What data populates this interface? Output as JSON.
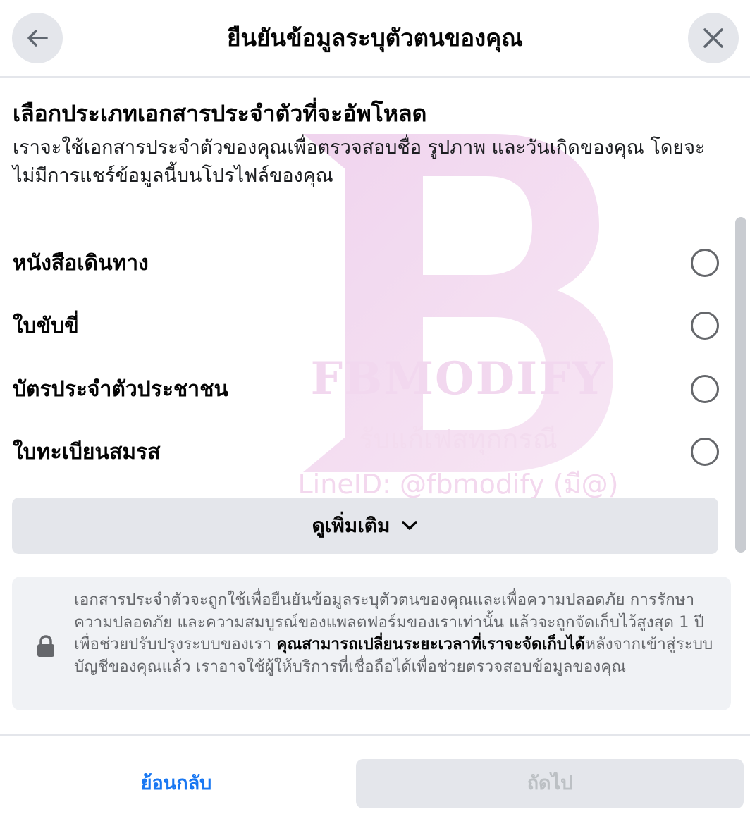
{
  "header": {
    "title": "ยืนยันข้อมูลระบุตัวตนของคุณ",
    "back_icon": "arrow-left-icon",
    "close_icon": "close-icon"
  },
  "watermark": {
    "brand": "FBMODIFY",
    "subtitle": "รับแก้เฟสทุกกรณี",
    "line_id": "LineID: @fbmodify (มี@)"
  },
  "section": {
    "title": "เลือกประเภทเอกสารประจำตัวที่จะอัพโหลด",
    "description": "เราจะใช้เอกสารประจำตัวของคุณเพื่อตรวจสอบชื่อ รูปภาพ และวันเกิดของคุณ โดยจะไม่มีการแชร์ข้อมูลนี้บนโปรไฟล์ของคุณ"
  },
  "options": [
    {
      "label": "หนังสือเดินทาง",
      "selected": false
    },
    {
      "label": "ใบขับขี่",
      "selected": false
    },
    {
      "label": "บัตรประจำตัวประชาชน",
      "selected": false
    },
    {
      "label": "ใบทะเบียนสมรส",
      "selected": false
    }
  ],
  "see_more": {
    "label": "ดูเพิ่มเติม",
    "icon": "chevron-down-icon"
  },
  "info": {
    "icon": "lock-icon",
    "text_part1": "เอกสารประจำตัวจะถูกใช้เพื่อยืนยันข้อมูลระบุตัวตนของคุณและเพื่อความปลอดภัย การรักษาความปลอดภัย และความสมบูรณ์ของแพลตฟอร์มของเราเท่านั้น แล้วจะถูกจัดเก็บไว้สูงสุด 1 ปีเพื่อช่วยปรับปรุงระบบของเรา ",
    "text_bold": "คุณสามารถเปลี่ยนระยะเวลาที่เราจะจัดเก็บได้",
    "text_part2": "หลังจากเข้าสู่ระบบบัญชีของคุณแล้ว เราอาจใช้ผู้ให้บริการที่เชื่อถือได้เพื่อช่วยตรวจสอบข้อมูลของคุณ"
  },
  "footer": {
    "back_label": "ย้อนกลับ",
    "next_label": "ถัดไป",
    "next_enabled": false
  },
  "colors": {
    "accent": "#1877f2",
    "button_gray": "#e4e6eb",
    "info_bg": "#f0f2f5",
    "muted_text": "#65676b",
    "disabled_text": "#bcc0c4",
    "watermark_pink": "#f2d8ef"
  }
}
